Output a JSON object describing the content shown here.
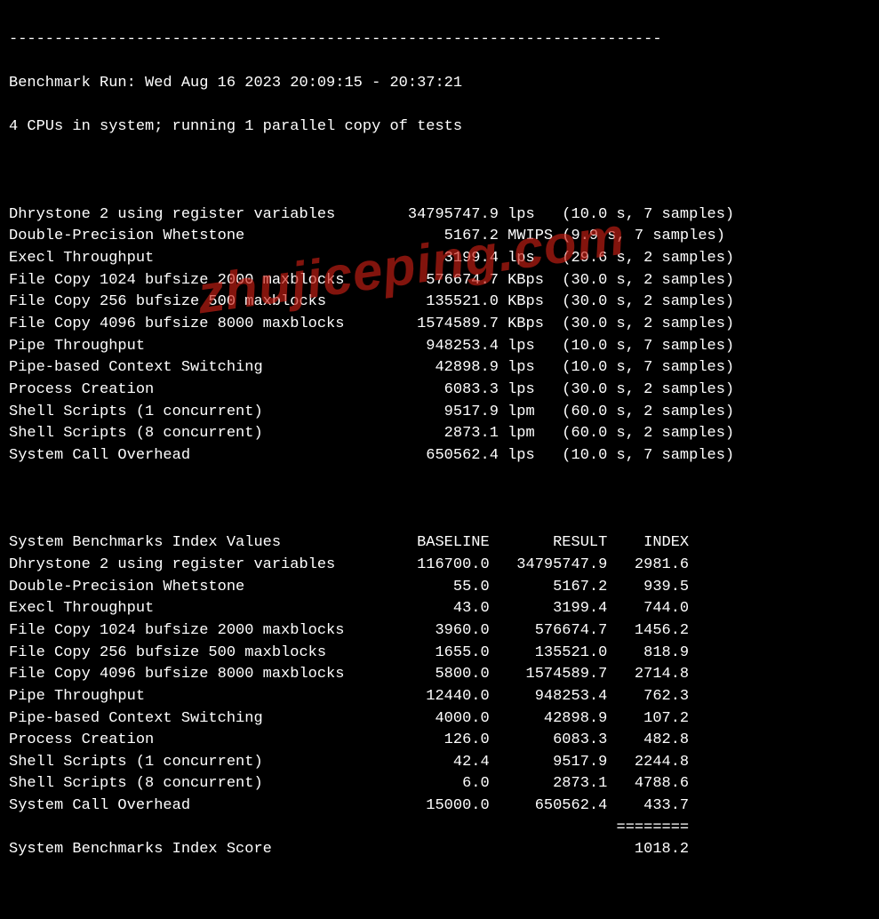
{
  "header": {
    "divider": "------------------------------------------------------------------------",
    "run_line": "Benchmark Run: Wed Aug 16 2023 20:09:15 - 20:37:21",
    "cpu_line": "4 CPUs in system; running 1 parallel copy of tests"
  },
  "tests": [
    {
      "name": "Dhrystone 2 using register variables",
      "value": "34795747.9",
      "unit": "lps",
      "timing": "(10.0 s, 7 samples)"
    },
    {
      "name": "Double-Precision Whetstone",
      "value": "5167.2",
      "unit": "MWIPS",
      "timing": "(9.9 s, 7 samples)"
    },
    {
      "name": "Execl Throughput",
      "value": "3199.4",
      "unit": "lps",
      "timing": "(29.6 s, 2 samples)"
    },
    {
      "name": "File Copy 1024 bufsize 2000 maxblocks",
      "value": "576674.7",
      "unit": "KBps",
      "timing": "(30.0 s, 2 samples)"
    },
    {
      "name": "File Copy 256 bufsize 500 maxblocks",
      "value": "135521.0",
      "unit": "KBps",
      "timing": "(30.0 s, 2 samples)"
    },
    {
      "name": "File Copy 4096 bufsize 8000 maxblocks",
      "value": "1574589.7",
      "unit": "KBps",
      "timing": "(30.0 s, 2 samples)"
    },
    {
      "name": "Pipe Throughput",
      "value": "948253.4",
      "unit": "lps",
      "timing": "(10.0 s, 7 samples)"
    },
    {
      "name": "Pipe-based Context Switching",
      "value": "42898.9",
      "unit": "lps",
      "timing": "(10.0 s, 7 samples)"
    },
    {
      "name": "Process Creation",
      "value": "6083.3",
      "unit": "lps",
      "timing": "(30.0 s, 2 samples)"
    },
    {
      "name": "Shell Scripts (1 concurrent)",
      "value": "9517.9",
      "unit": "lpm",
      "timing": "(60.0 s, 2 samples)"
    },
    {
      "name": "Shell Scripts (8 concurrent)",
      "value": "2873.1",
      "unit": "lpm",
      "timing": "(60.0 s, 2 samples)"
    },
    {
      "name": "System Call Overhead",
      "value": "650562.4",
      "unit": "lps",
      "timing": "(10.0 s, 7 samples)"
    }
  ],
  "index_table": {
    "title": "System Benchmarks Index Values",
    "headers": {
      "baseline": "BASELINE",
      "result": "RESULT",
      "index": "INDEX"
    },
    "rows": [
      {
        "name": "Dhrystone 2 using register variables",
        "baseline": "116700.0",
        "result": "34795747.9",
        "index": "2981.6"
      },
      {
        "name": "Double-Precision Whetstone",
        "baseline": "55.0",
        "result": "5167.2",
        "index": "939.5"
      },
      {
        "name": "Execl Throughput",
        "baseline": "43.0",
        "result": "3199.4",
        "index": "744.0"
      },
      {
        "name": "File Copy 1024 bufsize 2000 maxblocks",
        "baseline": "3960.0",
        "result": "576674.7",
        "index": "1456.2"
      },
      {
        "name": "File Copy 256 bufsize 500 maxblocks",
        "baseline": "1655.0",
        "result": "135521.0",
        "index": "818.9"
      },
      {
        "name": "File Copy 4096 bufsize 8000 maxblocks",
        "baseline": "5800.0",
        "result": "1574589.7",
        "index": "2714.8"
      },
      {
        "name": "Pipe Throughput",
        "baseline": "12440.0",
        "result": "948253.4",
        "index": "762.3"
      },
      {
        "name": "Pipe-based Context Switching",
        "baseline": "4000.0",
        "result": "42898.9",
        "index": "107.2"
      },
      {
        "name": "Process Creation",
        "baseline": "126.0",
        "result": "6083.3",
        "index": "482.8"
      },
      {
        "name": "Shell Scripts (1 concurrent)",
        "baseline": "42.4",
        "result": "9517.9",
        "index": "2244.8"
      },
      {
        "name": "Shell Scripts (8 concurrent)",
        "baseline": "6.0",
        "result": "2873.1",
        "index": "4788.6"
      },
      {
        "name": "System Call Overhead",
        "baseline": "15000.0",
        "result": "650562.4",
        "index": "433.7"
      }
    ],
    "score_row": {
      "label": "System Benchmarks Index Score",
      "underline": "========",
      "value": "1018.2"
    }
  },
  "watermark": "zhujiceping.com"
}
